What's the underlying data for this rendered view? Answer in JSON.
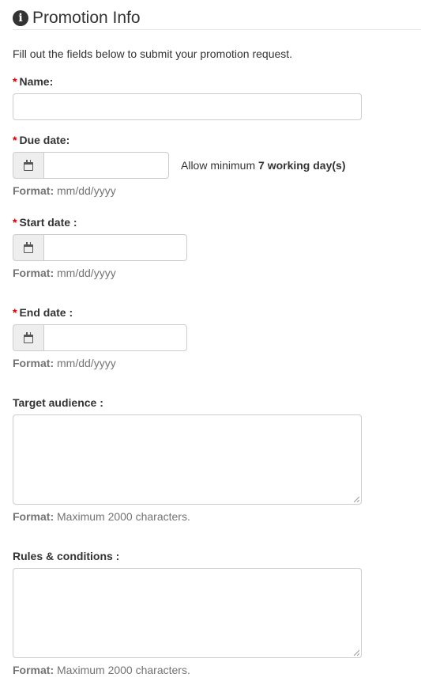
{
  "header": {
    "title": "Promotion Info",
    "icon": "info-circle-icon"
  },
  "intro": "Fill out the fields below to submit your promotion request.",
  "required_marker": "*",
  "format_prefix": "Format:",
  "fields": {
    "name": {
      "label": "Name:",
      "value": ""
    },
    "due_date": {
      "label": "Due date:",
      "value": "",
      "note_prefix": "Allow minimum",
      "note_bold": "7 working day(s)",
      "format": "mm/dd/yyyy",
      "icon": "calendar-icon"
    },
    "start_date": {
      "label": "Start date :",
      "value": "",
      "format": "mm/dd/yyyy",
      "icon": "calendar-icon"
    },
    "end_date": {
      "label": "End date :",
      "value": "",
      "format": "mm/dd/yyyy",
      "icon": "calendar-icon"
    },
    "target_audience": {
      "label": "Target audience :",
      "value": "",
      "format": "Maximum 2000 characters."
    },
    "rules": {
      "label": "Rules & conditions :",
      "value": "",
      "format": "Maximum 2000 characters."
    }
  },
  "colors": {
    "required": "#cc0000",
    "text": "#333333",
    "muted": "#737373",
    "border": "#cccccc",
    "addon_bg": "#eeeeee"
  }
}
